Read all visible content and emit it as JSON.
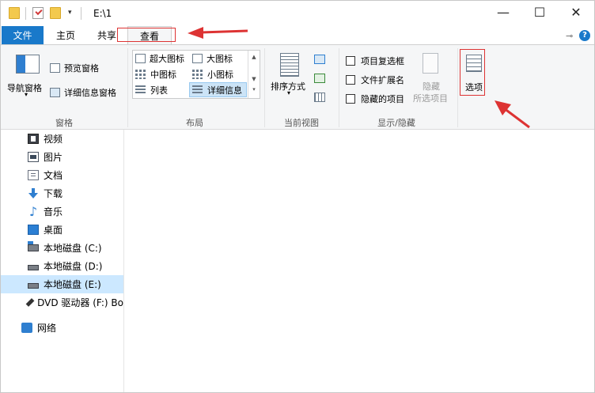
{
  "window": {
    "title": "E:\\1",
    "minimize": "—",
    "maximize": "☐",
    "close": "✕"
  },
  "quick_access": {
    "dropdown": "▾"
  },
  "tabs": {
    "file": "文件",
    "home": "主页",
    "share": "共享",
    "view": "查看"
  },
  "ribbon": {
    "pane": {
      "nav_pane": "导航窗格",
      "nav_pane_arrow": "▾",
      "preview_pane": "预览窗格",
      "details_pane": "详细信息窗格",
      "group_label": "窗格"
    },
    "layout": {
      "extra_large_icons": "超大图标",
      "large_icons": "大图标",
      "medium_icons": "中图标",
      "small_icons": "小图标",
      "list": "列表",
      "details": "详细信息",
      "group_label": "布局"
    },
    "current_view": {
      "sort_by": "排序方式",
      "sort_arrow": "▾",
      "group_label": "当前视图"
    },
    "show_hide": {
      "item_checkboxes": "项目复选框",
      "file_extensions": "文件扩展名",
      "hidden_items": "隐藏的项目",
      "hide_selected_line1": "隐藏",
      "hide_selected_line2": "所选项目",
      "group_label": "显示/隐藏"
    },
    "options": {
      "label": "选项"
    }
  },
  "nav_pane": {
    "items": [
      {
        "label": "视频",
        "icon": "video-icon"
      },
      {
        "label": "图片",
        "icon": "pictures-icon"
      },
      {
        "label": "文档",
        "icon": "documents-icon"
      },
      {
        "label": "下载",
        "icon": "downloads-icon"
      },
      {
        "label": "音乐",
        "icon": "music-icon"
      },
      {
        "label": "桌面",
        "icon": "desktop-icon"
      },
      {
        "label": "本地磁盘 (C:)",
        "icon": "drive-c-icon"
      },
      {
        "label": "本地磁盘 (D:)",
        "icon": "drive-icon"
      },
      {
        "label": "本地磁盘 (E:)",
        "icon": "drive-icon"
      },
      {
        "label": "DVD 驱动器 (F:) Bo",
        "icon": "dvd-drive-icon"
      },
      {
        "label": "网络",
        "icon": "network-icon"
      }
    ],
    "selected_index": 8
  },
  "colors": {
    "file_tab": "#1979ca",
    "annotation_red": "#dd3333",
    "selection": "#cce8ff"
  }
}
